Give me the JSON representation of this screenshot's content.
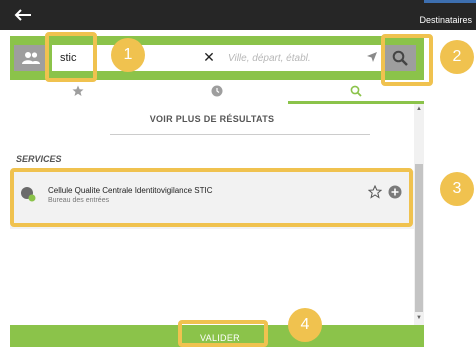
{
  "header": {
    "title": "Destinataires",
    "back_icon": "arrow-left-icon"
  },
  "search": {
    "query": "stic",
    "place_placeholder": "Ville, départ, établ.",
    "icons": {
      "people": "people-icon",
      "clear": "close-icon",
      "location": "location-arrow-icon",
      "search": "search-icon"
    }
  },
  "tabs": [
    {
      "icon": "star-icon",
      "active": false
    },
    {
      "icon": "clock-icon",
      "active": false
    },
    {
      "icon": "search-icon",
      "active": true
    }
  ],
  "results": {
    "more_label": "VOIR PLUS DE RÉSULTATS",
    "section_title": "SERVICES",
    "items": [
      {
        "name": "Cellule Qualite Centrale Identitovigilance STIC",
        "sub": "Bureau des entrées",
        "icon": "service-status-icon",
        "favorite_icon": "star-outline-icon",
        "add_icon": "plus-circle-icon"
      }
    ]
  },
  "footer": {
    "validate_label": "VALIDER"
  },
  "annotations": {
    "badges": [
      "1",
      "2",
      "3",
      "4"
    ],
    "color": "#f0c24f"
  },
  "colors": {
    "accent": "#8bc34a",
    "topbar": "#262626",
    "grey_button": "#9e9e9e"
  }
}
